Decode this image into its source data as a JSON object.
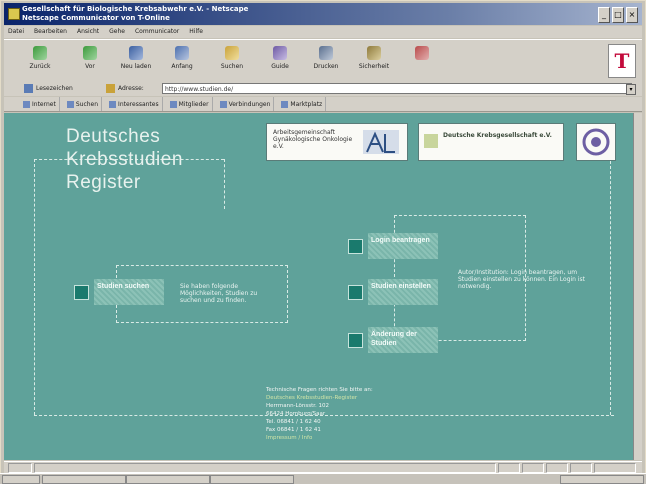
{
  "window": {
    "title_line1": "Gesellschaft für Biologische Krebsabwehr e.V. - Netscape",
    "title_line2": "Netscape Communicator von T-Online",
    "buttons": [
      "_",
      "□",
      "×"
    ]
  },
  "menu": [
    "Datei",
    "Bearbeiten",
    "Ansicht",
    "Gehe",
    "Communicator",
    "Hilfe"
  ],
  "toolbar": [
    {
      "label": "Zurück",
      "icon": "back-arrow-icon"
    },
    {
      "label": "Vor",
      "icon": "forward-arrow-icon"
    },
    {
      "label": "Neu laden",
      "icon": "reload-icon"
    },
    {
      "label": "Anfang",
      "icon": "home-icon"
    },
    {
      "label": "Suchen",
      "icon": "search-icon"
    },
    {
      "label": "Guide",
      "icon": "guide-icon"
    },
    {
      "label": "Drucken",
      "icon": "print-icon"
    },
    {
      "label": "Sicherheit",
      "icon": "lock-icon"
    },
    {
      "label": "",
      "icon": "stop-icon"
    }
  ],
  "brand_logo": "T",
  "location": {
    "bookmarks_label": "Lesezeichen",
    "address_label": "Adresse:",
    "url": "http://www.studien.de/"
  },
  "links": [
    "Internet",
    "Suchen",
    "Interessantes",
    "Mitglieder",
    "Verbindungen",
    "Marktplatz"
  ],
  "page": {
    "heading": [
      "Deutsches",
      "Krebsstudien",
      "Register"
    ],
    "partners": [
      {
        "text": "Arbeitsgemeinschaft Gynäkologische Onkologie e.V."
      },
      {
        "text": "Deutsche Krebsgesellschaft e.V."
      },
      {
        "text": ""
      }
    ],
    "nav_left": {
      "label": "Studien suchen",
      "desc": "Sie haben folgende Möglichkeiten, Studien zu suchen und zu finden."
    },
    "nav_right": [
      {
        "label": "Login beantragen"
      },
      {
        "label": "Studien einstellen"
      },
      {
        "label": "Änderung der Studien"
      }
    ],
    "right_desc": "Autor/Institution: Login beantragen, um Studien einstellen zu können. Ein Login ist notwendig.",
    "footer": [
      "Technische Fragen richten Sie bitte an:",
      "Deutsches Krebsstudien-Register",
      "Herrmann-Lönsstr. 102",
      "66424 Homburg/Saar",
      "Tel. 06841 / 1 62 40",
      "Fax 06841 / 1 62 41",
      "Impressum / Info"
    ]
  },
  "colors": {
    "page_bg": "#5fa29a",
    "nav_square": "#1a7a6d",
    "chrome": "#d4d0c8",
    "title_bar": "#0a246a"
  }
}
